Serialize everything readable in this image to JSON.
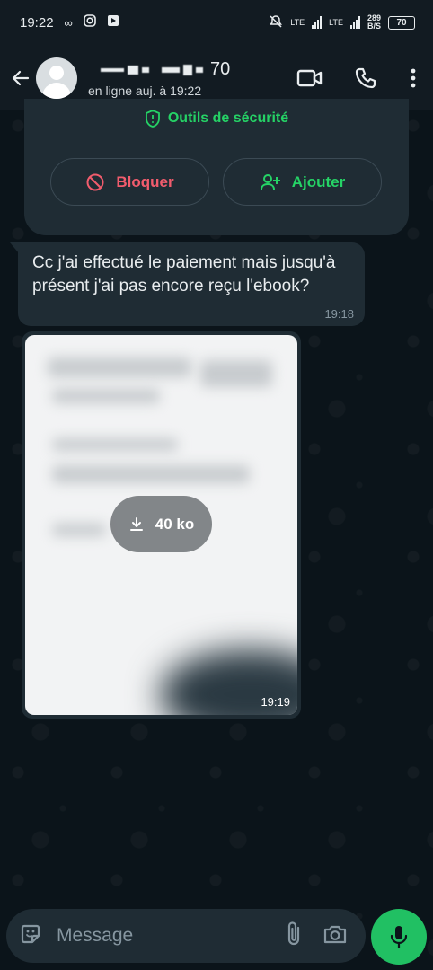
{
  "status_bar": {
    "time": "19:22",
    "net_type_1": "LTE",
    "net_type_2": "LTE",
    "speed_value": "289",
    "speed_unit": "B/S",
    "battery": "70"
  },
  "header": {
    "name_suffix": "70",
    "status": "en ligne auj. à 19:22"
  },
  "security_card": {
    "tools_label": "Outils de sécurité",
    "block_label": "Bloquer",
    "add_label": "Ajouter"
  },
  "messages": [
    {
      "text": "Cc j'ai effectué le paiement mais jusqu'à présent j'ai pas encore reçu l'ebook?",
      "time": "19:18"
    },
    {
      "download_size": "40 ko",
      "time": "19:19"
    }
  ],
  "composer": {
    "placeholder": "Message"
  },
  "colors": {
    "accent_green": "#25d366",
    "danger_red": "#f15c6d",
    "bubble": "#1f2c34",
    "background": "#0b141a"
  }
}
